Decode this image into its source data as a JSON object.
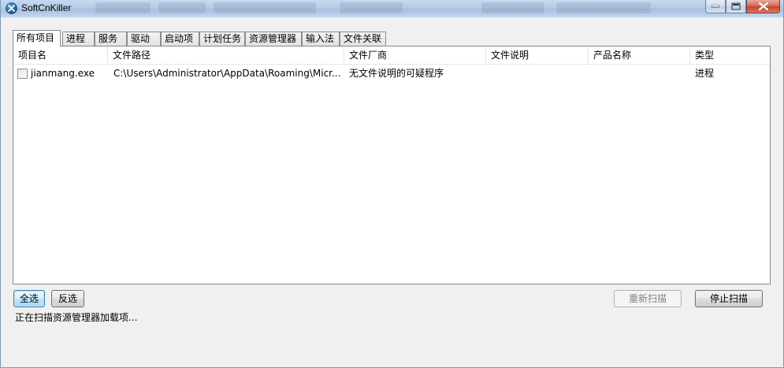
{
  "window": {
    "title": "SoftCnKiller",
    "icon": "app-icon",
    "caption_buttons": [
      "minimize-icon",
      "maximize-icon",
      "close-icon"
    ]
  },
  "tabs": [
    {
      "label": "所有项目",
      "active": true
    },
    {
      "label": "进程"
    },
    {
      "label": "服务"
    },
    {
      "label": "驱动"
    },
    {
      "label": "启动项"
    },
    {
      "label": "计划任务"
    },
    {
      "label": "资源管理器"
    },
    {
      "label": "输入法"
    },
    {
      "label": "文件关联"
    }
  ],
  "list": {
    "columns": [
      "项目名",
      "文件路径",
      "文件厂商",
      "文件说明",
      "产品名称",
      "类型"
    ],
    "rows": [
      {
        "checked": false,
        "name": "jianmang.exe",
        "path": "C:\\Users\\Administrator\\AppData\\Roaming\\Micr...",
        "vendor": "无文件说明的可疑程序",
        "description": "",
        "product": "",
        "type": "进程"
      }
    ]
  },
  "buttons": {
    "select_all": "全选",
    "invert": "反选",
    "rescan": "重新扫描",
    "stop_scan": "停止扫描"
  },
  "status": "正在扫描资源管理器加载项..."
}
